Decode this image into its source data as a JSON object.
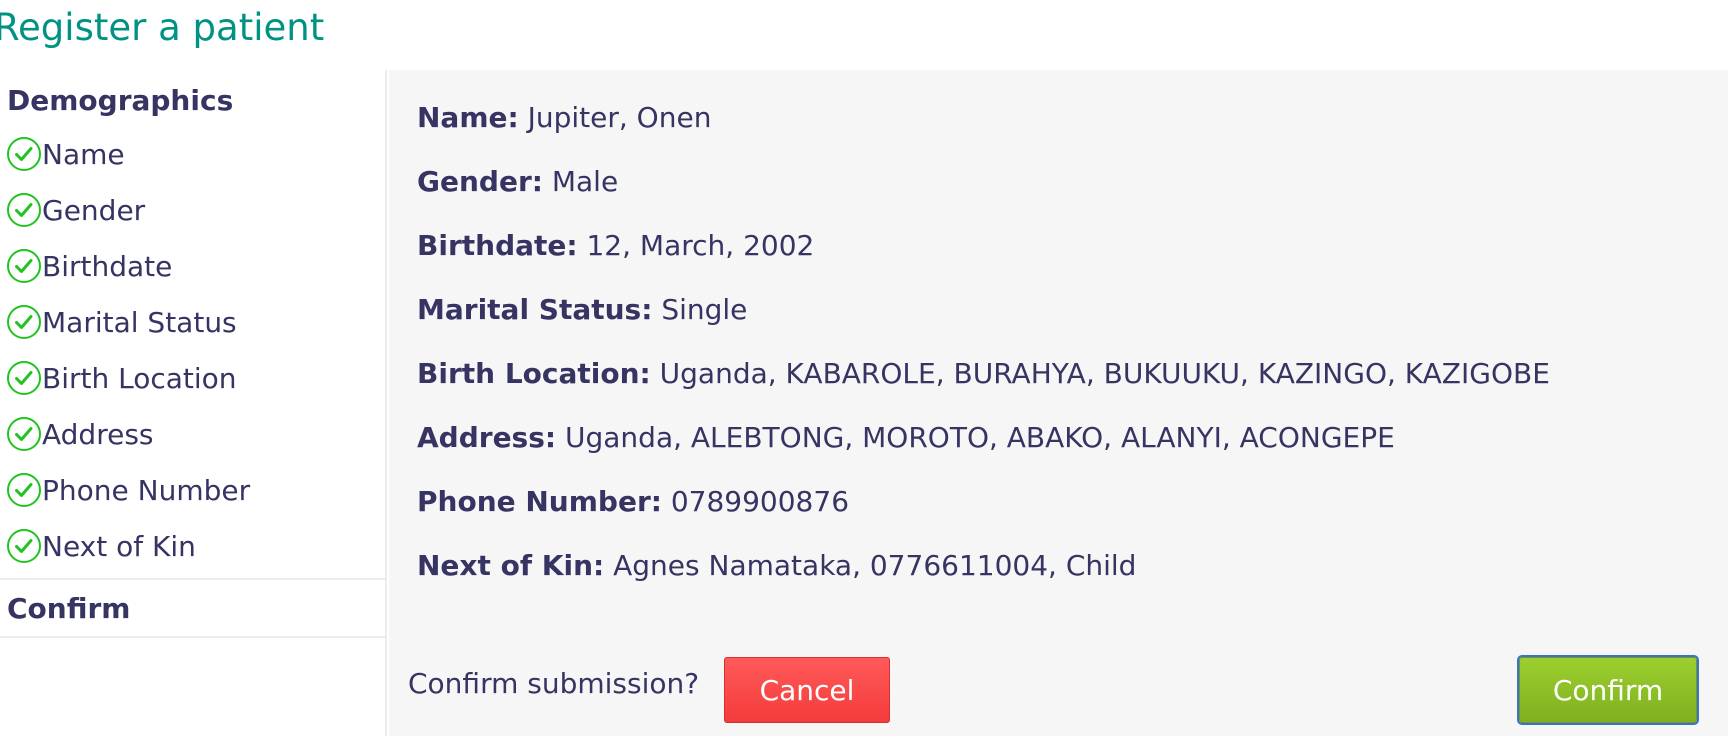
{
  "page": {
    "title": "Register a patient"
  },
  "sidebar": {
    "section_title": "Demographics",
    "items": [
      {
        "label": "Name",
        "icon": "check-circle-icon"
      },
      {
        "label": "Gender",
        "icon": "check-circle-icon"
      },
      {
        "label": "Birthdate",
        "icon": "check-circle-icon"
      },
      {
        "label": "Marital Status",
        "icon": "check-circle-icon"
      },
      {
        "label": "Birth Location",
        "icon": "check-circle-icon"
      },
      {
        "label": "Address",
        "icon": "check-circle-icon"
      },
      {
        "label": "Phone Number",
        "icon": "check-circle-icon"
      },
      {
        "label": "Next of Kin",
        "icon": "check-circle-icon"
      }
    ],
    "confirm_section_title": "Confirm"
  },
  "summary": [
    {
      "label": "Name:",
      "value": "Jupiter, Onen"
    },
    {
      "label": "Gender:",
      "value": "Male"
    },
    {
      "label": "Birthdate:",
      "value": "12, March, 2002"
    },
    {
      "label": "Marital Status:",
      "value": "Single"
    },
    {
      "label": "Birth Location:",
      "value": "Uganda, KABAROLE, BURAHYA, BUKUUKU, KAZINGO, KAZIGOBE"
    },
    {
      "label": "Address:",
      "value": "Uganda, ALEBTONG, MOROTO, ABAKO, ALANYI, ACONGEPE"
    },
    {
      "label": "Phone Number:",
      "value": "0789900876"
    },
    {
      "label": "Next of Kin:",
      "value": "Agnes Namataka, 0776611004, Child"
    }
  ],
  "confirm": {
    "question": "Confirm submission?",
    "cancel_label": "Cancel",
    "confirm_label": "Confirm"
  },
  "colors": {
    "title": "#009384",
    "text": "#363463",
    "check": "#1fc41f",
    "cancel": "#f43b3b",
    "confirm": "#8ac126",
    "panel_bg": "#f6f6f6"
  }
}
